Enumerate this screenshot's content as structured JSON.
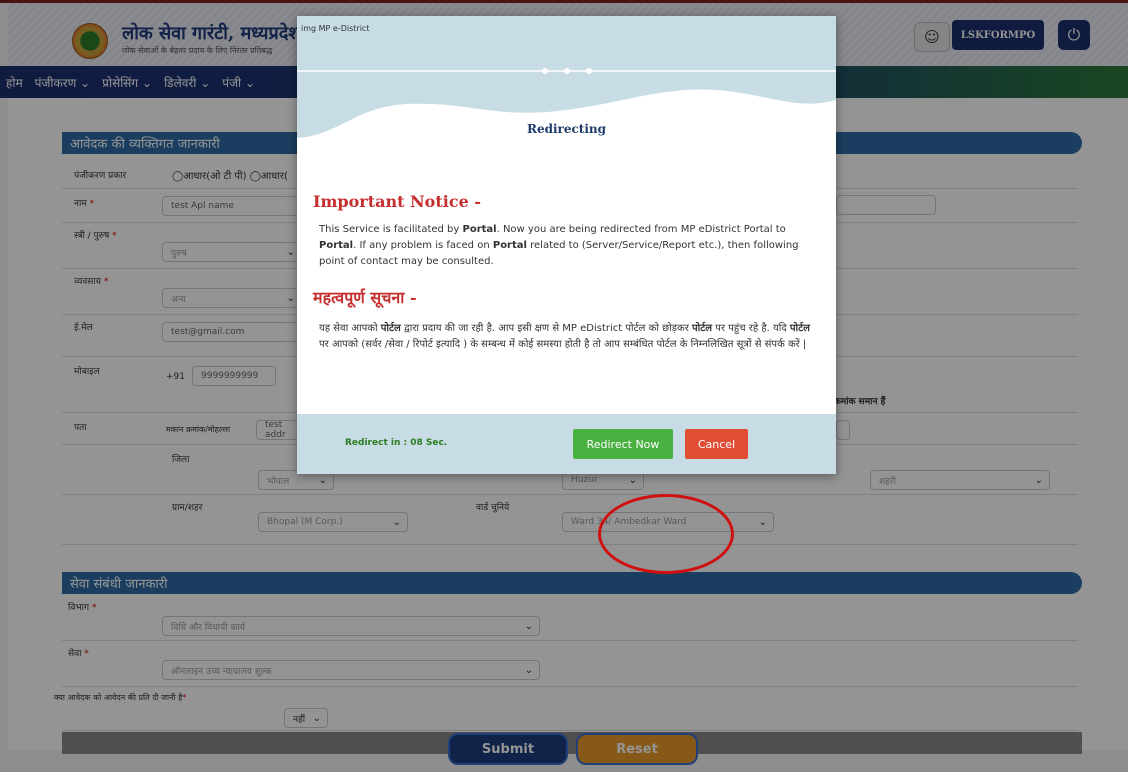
{
  "header": {
    "site_title": "लोक सेवा गारंटी, मध्यप्रदेश",
    "site_subtitle": "लोक सेवाओं के बेहतर प्रदाय के लिए निरंतर प्रतिबद्ध",
    "username": "LSKFORMPO"
  },
  "nav": {
    "items": [
      "होम",
      "पंजीकरण ⌄",
      "प्रोसेसिंग ⌄",
      "डिलेवरी ⌄",
      "पंजी ⌄"
    ]
  },
  "form": {
    "section_personal": "आवेदक की व्यक्तिगत जानकारी",
    "reg_type_label": "पंजीकरण प्रकार",
    "reg_type_option": "◯आधार(ओ टी पी) ◯आधार(",
    "name_label": "नाम",
    "name_value": "test Apl name",
    "gender_label": "स्त्री / पुरुष",
    "gender_value": "पुरुष",
    "occupation_label": "व्यवसाय",
    "occupation_value": "अन्य",
    "email_label": "ई.मेल",
    "email_value": "test@gmail.com",
    "mobile_label": "मोबाइल",
    "mobile_prefix": "+91",
    "mobile_value": "9999999999",
    "mobile_note": "क्रमांक समान हैं",
    "address_label": "पता",
    "house_label": "मकान क्रमांक/मोहल्ला",
    "house_value": "test addr",
    "district_label": "जिला",
    "district_value": "भोपाल",
    "tehsil_value": "Huzur",
    "urban_value": "शहरी",
    "village_label": "ग्राम/शहर",
    "village_value": "Bhopal (M Corp.)",
    "ward_label": "वार्ड चुनिये",
    "ward_value": "Ward 34/ Ambedkar Ward",
    "section_service": "सेवा संबंधी जानकारी",
    "department_label": "विभाग",
    "department_value": "विधि और विधायी कार्य",
    "service_label": "सेवा",
    "service_value": "ऑनलाइन उच्च न्यायालय शुल्क",
    "copy_question": "क्या आवेदक को आवेदन की प्रति दी जानी है",
    "copy_value": "नहीं",
    "submit": "Submit",
    "reset": "Reset"
  },
  "modal": {
    "img_alt": "img MP e-District",
    "heading": "Redirecting",
    "notice_title_en": "Important Notice -",
    "notice_en_1": "This Service is facilitated by ",
    "portal_1": "Portal",
    "notice_en_2": ". Now you are being redirected from MP eDistrict Portal to ",
    "portal_2": "Portal",
    "notice_en_3": ". If any problem is faced on ",
    "portal_3": "Portal",
    "notice_en_4": " related to (Server/Service/Report etc.), then following point of contact may be consulted.",
    "notice_title_hi": "महत्वपूर्ण सूचना -",
    "notice_hi_1": "यह सेवा आपको ",
    "portal_hi_1": "पोर्टल",
    "notice_hi_2": " द्वारा प्रदाय की जा रही है. आप इसी क्षण से MP eDistrict पोर्टल को छोड़कर ",
    "portal_hi_2": "पोर्टल",
    "notice_hi_3": " पर पहुंच रहे है. यदि ",
    "portal_hi_3": "पोर्टल",
    "notice_hi_4": " पर आपको (सर्वर /सेवा / रिपोर्ट इत्यादि ) के सम्बन्ध में कोई समस्या होती है तो आप सम्बंधित पोर्टल के निम्नलिखित सूत्रों से संपर्क करें |",
    "countdown": "Redirect in : 08 Sec.",
    "redirect_now": "Redirect Now",
    "cancel": "Cancel"
  },
  "colors": {
    "navy": "#1c2f6f",
    "section_blue": "#2f6ba6",
    "notice_red": "#c62e2e",
    "green_button": "#4ab042",
    "red_button": "#e04e35",
    "annotation_red": "#d01010"
  }
}
